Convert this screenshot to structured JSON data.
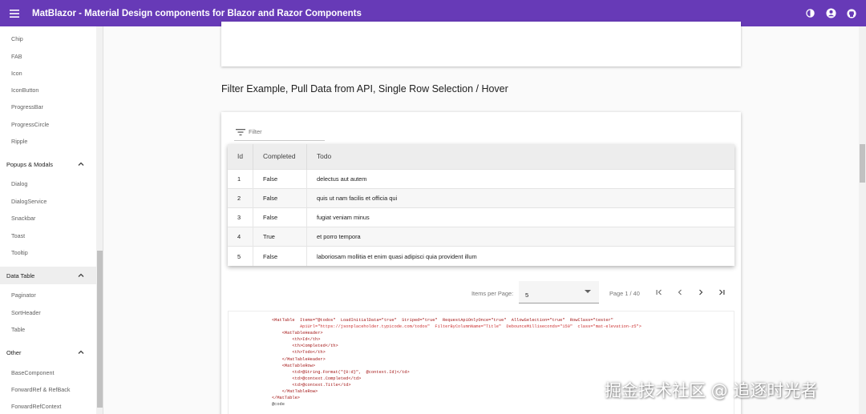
{
  "app": {
    "title": "MatBlazor - Material Design components for Blazor and Razor Components"
  },
  "topbar": {
    "icons": [
      "menu-icon",
      "theme-icon",
      "account-icon",
      "github-icon"
    ]
  },
  "sidebar": {
    "items_top": [
      "Chip",
      "FAB",
      "Icon",
      "IconButton",
      "ProgressBar",
      "ProgressCircle",
      "Ripple"
    ],
    "group_popups": "Popups & Modals",
    "items_popups": [
      "Dialog",
      "DialogService",
      "Snackbar",
      "Toast",
      "Tooltip"
    ],
    "group_datatable": "Data Table",
    "items_datatable": [
      "Paginator",
      "SortHeader",
      "Table"
    ],
    "group_other": "Other",
    "items_other": [
      "BaseComponent",
      "ForwardRef & RefBack",
      "ForwardRefContext"
    ]
  },
  "main": {
    "section_title": "Filter Example, Pull Data from API, Single Row Selection / Hover",
    "filter": {
      "placeholder": "Filter",
      "value": ""
    },
    "table": {
      "headers": [
        "Id",
        "Completed",
        "Todo"
      ],
      "rows": [
        [
          "1",
          "False",
          "delectus aut autem"
        ],
        [
          "2",
          "False",
          "quis ut nam facilis et officia qui"
        ],
        [
          "3",
          "False",
          "fugiat veniam minus"
        ],
        [
          "4",
          "True",
          "et porro tempora"
        ],
        [
          "5",
          "False",
          "laboriosam mollitia et enim quasi adipisci quia provident illum"
        ]
      ]
    },
    "paginator": {
      "items_per_page_label": "Items per Page:",
      "page_size": "5",
      "status": "Page 1 / 40"
    },
    "code_lines": [
      "<MatTable  Items=\"@todos\"  LoadInitialData=\"true\"  Striped=\"true\"  RequestApiOnlyOnce=\"true\"  AllowSelection=\"true\"  RowClass=\"tester\"",
      "           ApiUrl=\"https://jsonplaceholder.typicode.com/todos\"  FilterByColumnName=\"Title\"  DebounceMilliseconds=\"150\"  class=\"mat-elevation-z5\">",
      "    <MatTableHeader>",
      "        <th>Id</th>",
      "        <th>Completed</th>",
      "        <th>Todo</th>",
      "    </MatTableHeader>",
      "    <MatTableRow>",
      "        <td>@String.Format(\"{0:d}\",  @context.Id)</td>",
      "        <td>@context.Completed</td>",
      "        <td>@context.Title</td>",
      "    </MatTableRow>",
      "</MatTable>",
      "",
      "@code"
    ]
  },
  "watermark": "掘金技术社区 @ 追逐时光者"
}
